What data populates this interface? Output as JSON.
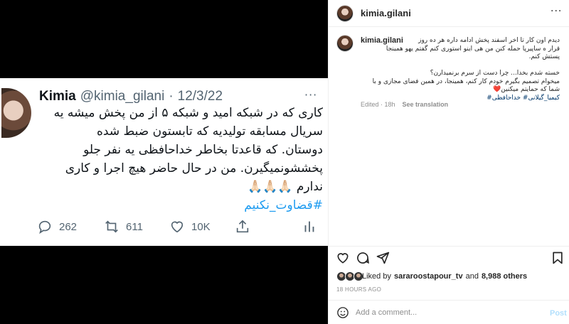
{
  "tweet": {
    "name": "Kimia",
    "handle": "@kimia_gilani",
    "dot": "·",
    "date": "12/3/22",
    "more": "···",
    "lines": [
      "کاری که در شبکه امید و شبکه ۵ از من پخش میشه یه",
      "سریال مسابقه تولیدیه که تابستون ضبط شده",
      "دوستان. که قاعدتا بخاطر خداحافظی یه نفر جلو",
      "پخششونمیگیرن. من در حال حاضر هیچ اجرا و کاری",
      "ندارم 🙏🏻🙏🏻🙏🏻"
    ],
    "hashtag": "#قضاوت_نکنیم",
    "actions": {
      "replies": "262",
      "retweets": "611",
      "likes": "10K"
    }
  },
  "post": {
    "username": "kimia.gilani",
    "more": "···",
    "caption_user": "kimia.gilani",
    "caption_lines": [
      "دیدم اون کار تا اخر اسفند پخش ادامه داره هر ده روز",
      "قرار ه ساپیرپا حمله کنن من هی اینو استوری کنم گفتم یهو همینجا",
      "پستش کنم.",
      "",
      "خسته شدم بخدا... چرا دست از سرم برنمیدارن؟",
      "میخوام تصمیم بگیرم خودم کار کنم، همینجا، در همین فضای مجازی و با",
      "شما که حمایتم میکنین❤️",
      "کیمیا_گیلانی# خداحافظی#"
    ],
    "edited": "Edited · 18h",
    "see_translation": "See translation",
    "liked_prefix": "Liked by",
    "liked_user": "sararoostapour_tv",
    "liked_and": "and",
    "liked_others": "8,988 others",
    "time": "18 HOURS AGO",
    "comment_placeholder": "Add a comment...",
    "post_label": "Post"
  },
  "icons": {
    "like": "heart-icon",
    "comment": "comment-icon",
    "share": "send-icon",
    "save": "bookmark-icon",
    "emoji": "smiley-icon"
  },
  "colors": {
    "twitter_blue": "#1d9bf0",
    "ig_link": "#00376b",
    "post_disabled": "#b2dffc"
  }
}
